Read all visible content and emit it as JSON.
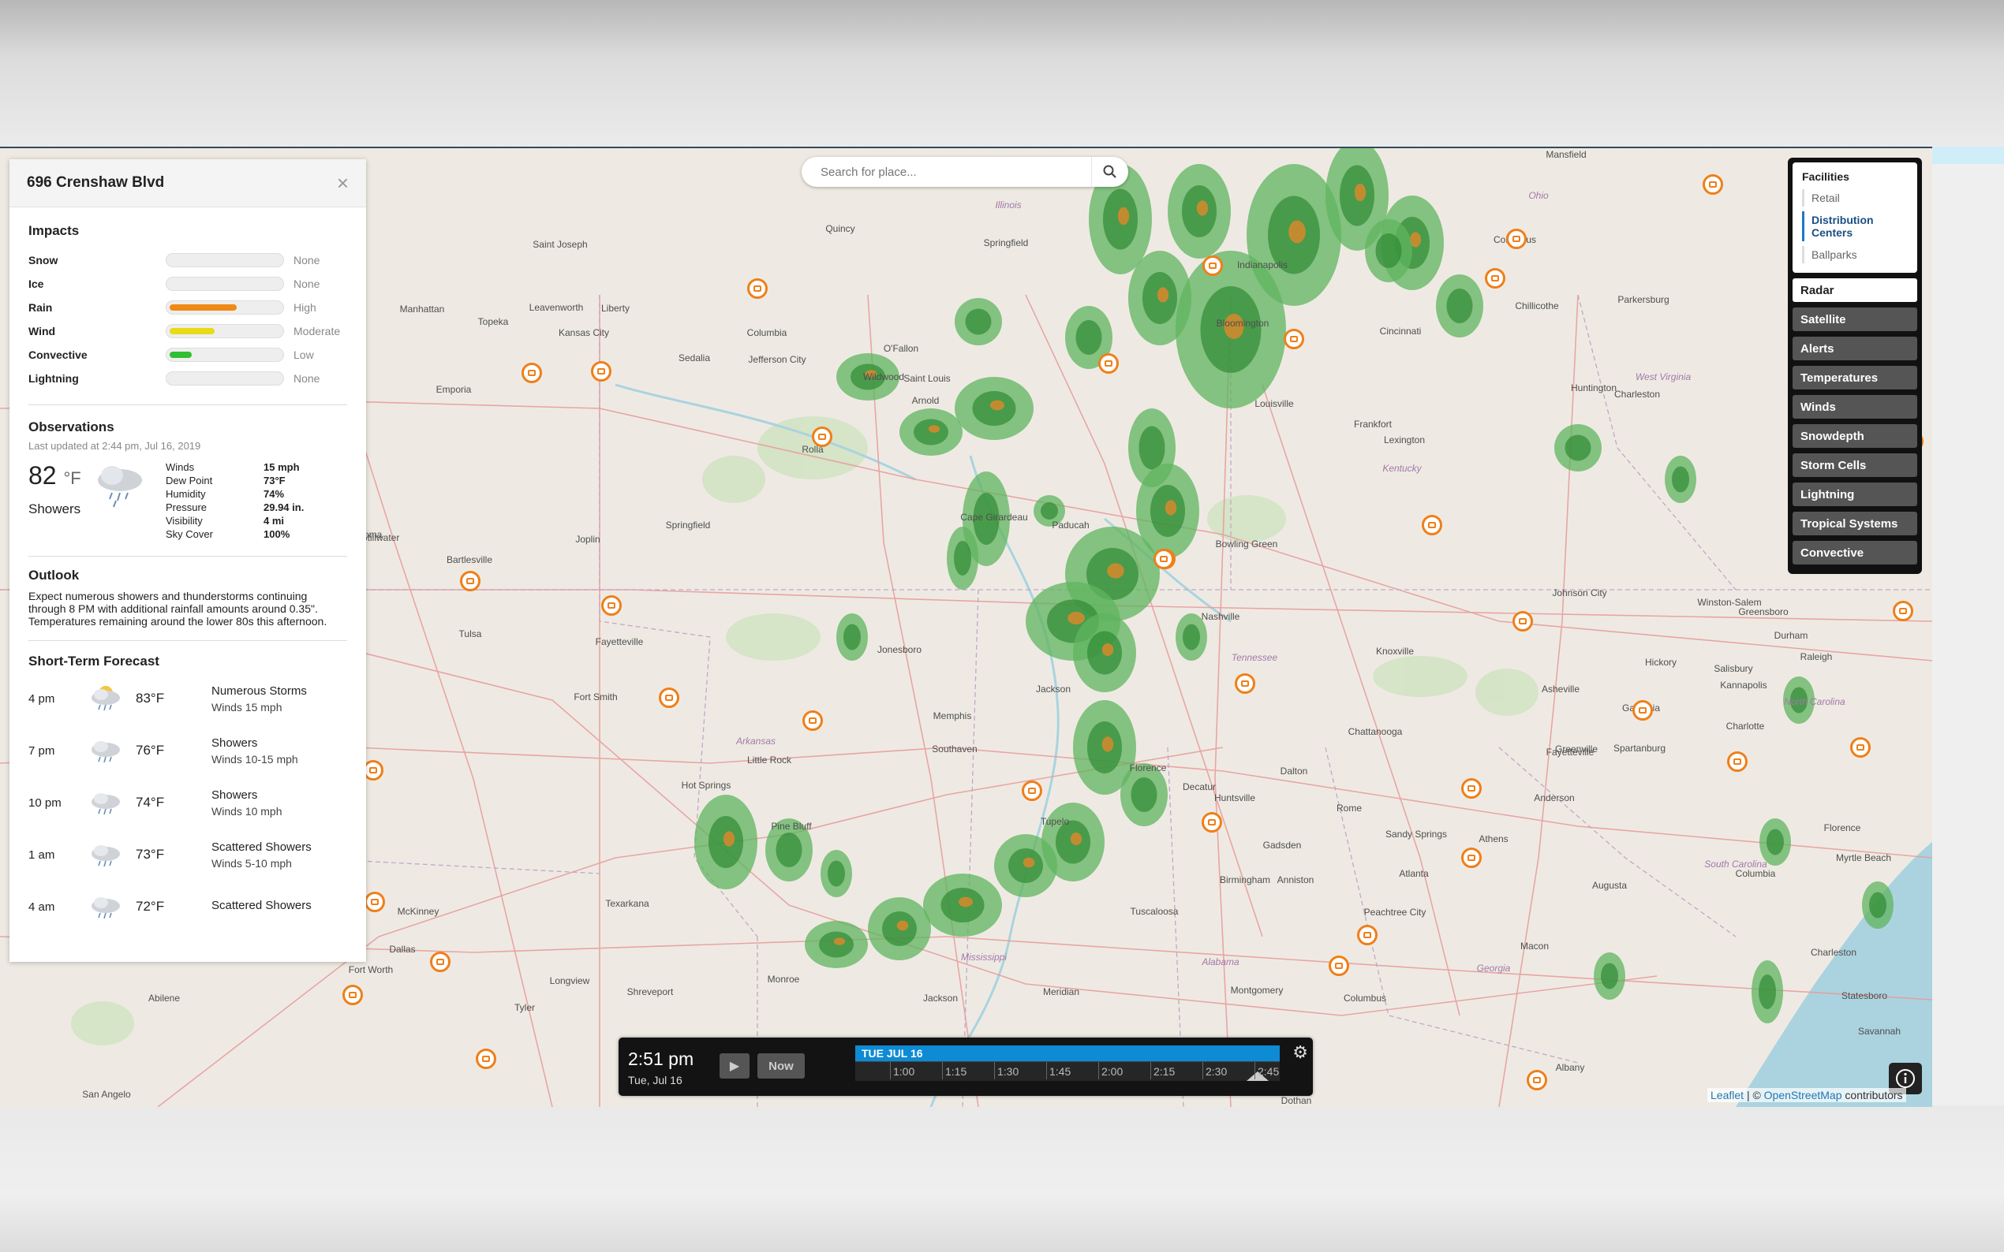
{
  "search": {
    "placeholder": "Search for place..."
  },
  "panel": {
    "title": "696 Crenshaw Blvd",
    "impacts_title": "Impacts",
    "impacts": [
      {
        "name": "Snow",
        "level": "None",
        "fraction": 0,
        "color": "#d9d9d9"
      },
      {
        "name": "Ice",
        "level": "None",
        "fraction": 0,
        "color": "#d9d9d9"
      },
      {
        "name": "Rain",
        "level": "High",
        "fraction": 0.6,
        "color": "#f08a16"
      },
      {
        "name": "Wind",
        "level": "Moderate",
        "fraction": 0.4,
        "color": "#e7dc17"
      },
      {
        "name": "Convective",
        "level": "Low",
        "fraction": 0.2,
        "color": "#2fbf2f"
      },
      {
        "name": "Lightning",
        "level": "None",
        "fraction": 0,
        "color": "#d9d9d9"
      }
    ],
    "observations_title": "Observations",
    "last_updated": "Last updated at 2:44 pm, Jul 16, 2019",
    "temp": "82",
    "temp_unit": "°F",
    "condition": "Showers",
    "obs_rows": [
      {
        "k": "Winds",
        "v": "15 mph"
      },
      {
        "k": "Dew Point",
        "v": "73°F"
      },
      {
        "k": "Humidity",
        "v": "74%"
      },
      {
        "k": "Pressure",
        "v": "29.94 in."
      },
      {
        "k": "Visibility",
        "v": "4 mi"
      },
      {
        "k": "Sky Cover",
        "v": "100%"
      }
    ],
    "outlook_title": "Outlook",
    "outlook_text": "Expect numerous showers and thunderstorms continuing through 8 PM with additional rainfall amounts around 0.35\". Temperatures remaining around the lower 80s this afternoon.",
    "forecast_title": "Short-Term Forecast",
    "forecast": [
      {
        "time": "4 pm",
        "temp": "83°F",
        "desc": "Numerous Storms",
        "wind": "Winds 15 mph",
        "icon": "storm-sun-icon"
      },
      {
        "time": "7 pm",
        "temp": "76°F",
        "desc": "Showers",
        "wind": "Winds 10-15 mph",
        "icon": "rain-cloud-icon"
      },
      {
        "time": "10 pm",
        "temp": "74°F",
        "desc": "Showers",
        "wind": "Winds 10 mph",
        "icon": "rain-cloud-icon"
      },
      {
        "time": "1 am",
        "temp": "73°F",
        "desc": "Scattered Showers",
        "wind": "Winds 5-10 mph",
        "icon": "rain-cloud-icon"
      },
      {
        "time": "4 am",
        "temp": "72°F",
        "desc": "Scattered Showers",
        "wind": "",
        "icon": "rain-cloud-icon"
      }
    ]
  },
  "layers": {
    "facilities_title": "Facilities",
    "facilities": [
      "Retail",
      "Distribution Centers",
      "Ballparks"
    ],
    "active_facility": "Distribution Centers",
    "buttons": [
      "Radar",
      "Satellite",
      "Alerts",
      "Temperatures",
      "Winds",
      "Snowdepth",
      "Storm Cells",
      "Lightning",
      "Tropical Systems",
      "Convective"
    ],
    "active_button": "Radar"
  },
  "timeline": {
    "time": "2:51 pm",
    "date": "Tue, Jul 16",
    "now_label": "Now",
    "day_label": "TUE JUL 16",
    "ticks": [
      "1:00",
      "1:15",
      "1:30",
      "1:45",
      "2:00",
      "2:15",
      "2:30",
      "2:45"
    ]
  },
  "attribution": {
    "leaflet": "Leaflet",
    "sep": "| ©",
    "osm": "OpenStreetMap",
    "suffix": "contributors"
  },
  "map": {
    "cities": [
      "Mansfield",
      "Ohio",
      "Columbus",
      "Indianapolis",
      "Springfield",
      "Illinois",
      "Quincy",
      "Bloomington",
      "Cincinnati",
      "Saint Joseph",
      "Manhattan",
      "Topeka",
      "Leavenworth",
      "Liberty",
      "Kansas City",
      "Columbia",
      "Jefferson City",
      "O'Fallon",
      "Saint Louis",
      "Sedalia",
      "Wildwood",
      "Arnold",
      "Emporia",
      "Louisville",
      "Frankfort",
      "Lexington",
      "Chillicothe",
      "Huntington",
      "West Virginia",
      "Charleston",
      "Parkersburg",
      "Cape Girardeau",
      "Paducah",
      "Kentucky",
      "Springfield",
      "Joplin",
      "Rolla",
      "Bowling Green",
      "Bartlesville",
      "Tulsa",
      "Fayetteville",
      "Nashville",
      "Knoxville",
      "Tennessee",
      "Johnson City",
      "Winston-Salem",
      "Greensboro",
      "Durham",
      "Raleigh",
      "Jonesboro",
      "Jackson",
      "Memphis",
      "Fort Smith",
      "Hickory",
      "Salisbury",
      "Kannapolis",
      "Charlotte",
      "North Carolina",
      "Gastonia",
      "Fayetteville",
      "Chattanooga",
      "Asheville",
      "Southaven",
      "Little Rock",
      "Arkansas",
      "Hot Springs",
      "Pine Bluff",
      "Florence",
      "Decatur",
      "Huntsville",
      "Dalton",
      "Greenville",
      "Spartanburg",
      "Anderson",
      "South Carolina",
      "Florence",
      "Myrtle Beach",
      "Tupelo",
      "Rome",
      "Athens",
      "Sandy Springs",
      "Atlanta",
      "Augusta",
      "Columbia",
      "Gadsden",
      "Birmingham",
      "Anniston",
      "Texarkana",
      "Tuscaloosa",
      "Peachtree City",
      "Macon",
      "Georgia",
      "Alabama",
      "Mississippi",
      "Charleston",
      "Statesboro",
      "Savannah",
      "McKinney",
      "Dallas",
      "Fort Worth",
      "Longview",
      "Shreveport",
      "Monroe",
      "Jackson",
      "Meridian",
      "Montgomery",
      "Columbus",
      "Albany",
      "Tyler",
      "Abilene",
      "San Angelo",
      "Dothan",
      "Oklahoma",
      "Stillwater"
    ]
  }
}
